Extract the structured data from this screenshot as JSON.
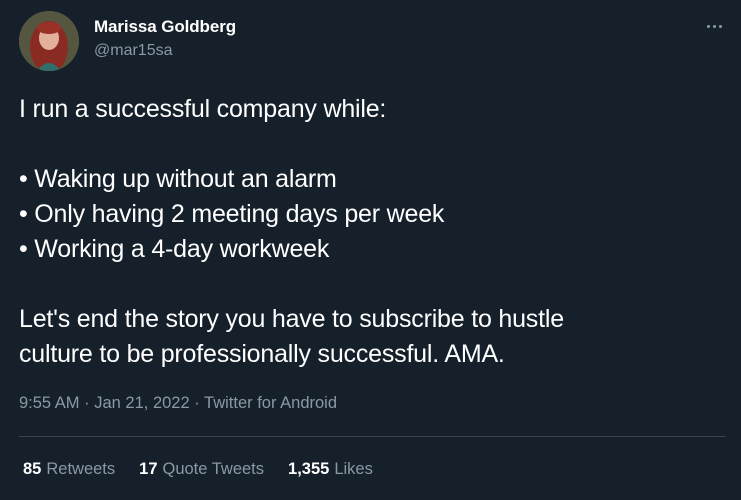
{
  "author": {
    "name": "Marissa Goldberg",
    "handle": "@mar15sa"
  },
  "icons": {
    "avatar": "profile-photo",
    "more": "more-options-icon"
  },
  "tweet": {
    "lines": [
      "I run a successful company while:",
      "",
      "• Waking up without an alarm",
      "• Only having 2 meeting days per week",
      "• Working a 4-day workweek",
      "",
      "Let's end the story you have to subscribe to hustle",
      "culture to be professionally successful. AMA."
    ],
    "time": "9:55 AM",
    "sep1": "·",
    "date": "Jan 21, 2022",
    "sep2": "·",
    "source": "Twitter for Android"
  },
  "stats": [
    {
      "num": "85",
      "label": "Retweets"
    },
    {
      "num": "17",
      "label": "Quote Tweets"
    },
    {
      "num": "1,355",
      "label": "Likes"
    }
  ],
  "colors": {
    "background": "#15202b",
    "text": "#ffffff",
    "secondary": "#8b98a5",
    "divider": "#38444d"
  }
}
